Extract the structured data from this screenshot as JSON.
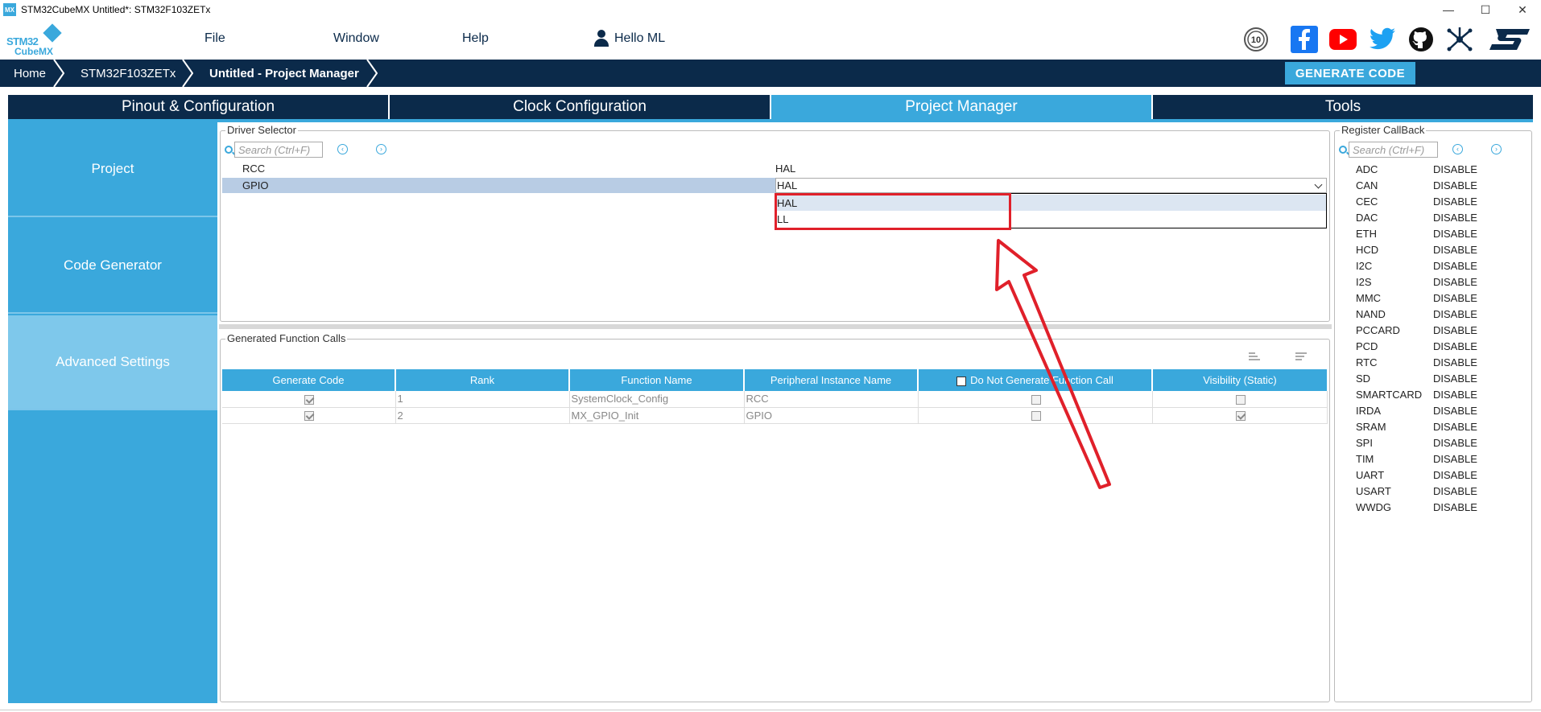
{
  "window": {
    "app_icon": "MX",
    "title": "STM32CubeMX Untitled*: STM32F103ZETx",
    "controls": [
      "—",
      "☐",
      "✕"
    ]
  },
  "logo": {
    "line1": "STM32",
    "line2": "CubeMX"
  },
  "menu": {
    "file": "File",
    "window": "Window",
    "help": "Help",
    "user": "Hello ML"
  },
  "social_icons": [
    "anniversary-10-icon",
    "facebook-icon",
    "youtube-icon",
    "twitter-icon",
    "github-icon",
    "network-icon",
    "st-logo-icon"
  ],
  "breadcrumb": {
    "home": "Home",
    "mcu": "STM32F103ZETx",
    "current": "Untitled - Project Manager"
  },
  "generate_code_label": "GENERATE CODE",
  "tabs": {
    "pinout": "Pinout & Configuration",
    "clock": "Clock Configuration",
    "project_manager": "Project Manager",
    "tools": "Tools"
  },
  "left_nav": {
    "project": "Project",
    "code_generator": "Code Generator",
    "advanced": "Advanced Settings"
  },
  "driver_selector": {
    "legend": "Driver Selector",
    "search_placeholder": "Search (Ctrl+F)",
    "rows": [
      {
        "name": "RCC",
        "value": "HAL"
      },
      {
        "name": "GPIO",
        "value": "HAL"
      }
    ],
    "dropdown_options": [
      "HAL",
      "LL"
    ]
  },
  "function_calls": {
    "legend": "Generated Function Calls",
    "headers": {
      "generate_code": "Generate Code",
      "rank": "Rank",
      "function_name": "Function Name",
      "peripheral": "Peripheral Instance Name",
      "do_not_generate": "Do Not Generate Function Call",
      "visibility": "Visibility (Static)"
    },
    "rows": [
      {
        "generate": true,
        "rank": "1",
        "function": "SystemClock_Config",
        "peripheral": "RCC",
        "do_not_generate": false,
        "visibility": false
      },
      {
        "generate": true,
        "rank": "2",
        "function": "MX_GPIO_Init",
        "peripheral": "GPIO",
        "do_not_generate": false,
        "visibility": true
      }
    ]
  },
  "register_callback": {
    "legend": "Register CallBack",
    "search_placeholder": "Search (Ctrl+F)",
    "items": [
      {
        "name": "ADC",
        "value": "DISABLE"
      },
      {
        "name": "CAN",
        "value": "DISABLE"
      },
      {
        "name": "CEC",
        "value": "DISABLE"
      },
      {
        "name": "DAC",
        "value": "DISABLE"
      },
      {
        "name": "ETH",
        "value": "DISABLE"
      },
      {
        "name": "HCD",
        "value": "DISABLE"
      },
      {
        "name": "I2C",
        "value": "DISABLE"
      },
      {
        "name": "I2S",
        "value": "DISABLE"
      },
      {
        "name": "MMC",
        "value": "DISABLE"
      },
      {
        "name": "NAND",
        "value": "DISABLE"
      },
      {
        "name": "PCCARD",
        "value": "DISABLE"
      },
      {
        "name": "PCD",
        "value": "DISABLE"
      },
      {
        "name": "RTC",
        "value": "DISABLE"
      },
      {
        "name": "SD",
        "value": "DISABLE"
      },
      {
        "name": "SMARTCARD",
        "value": "DISABLE"
      },
      {
        "name": "IRDA",
        "value": "DISABLE"
      },
      {
        "name": "SRAM",
        "value": "DISABLE"
      },
      {
        "name": "SPI",
        "value": "DISABLE"
      },
      {
        "name": "TIM",
        "value": "DISABLE"
      },
      {
        "name": "UART",
        "value": "DISABLE"
      },
      {
        "name": "USART",
        "value": "DISABLE"
      },
      {
        "name": "WWDG",
        "value": "DISABLE"
      }
    ]
  },
  "colors": {
    "navy": "#0b2a4a",
    "accent": "#3aa8dc",
    "annotation_red": "#e0202a"
  }
}
